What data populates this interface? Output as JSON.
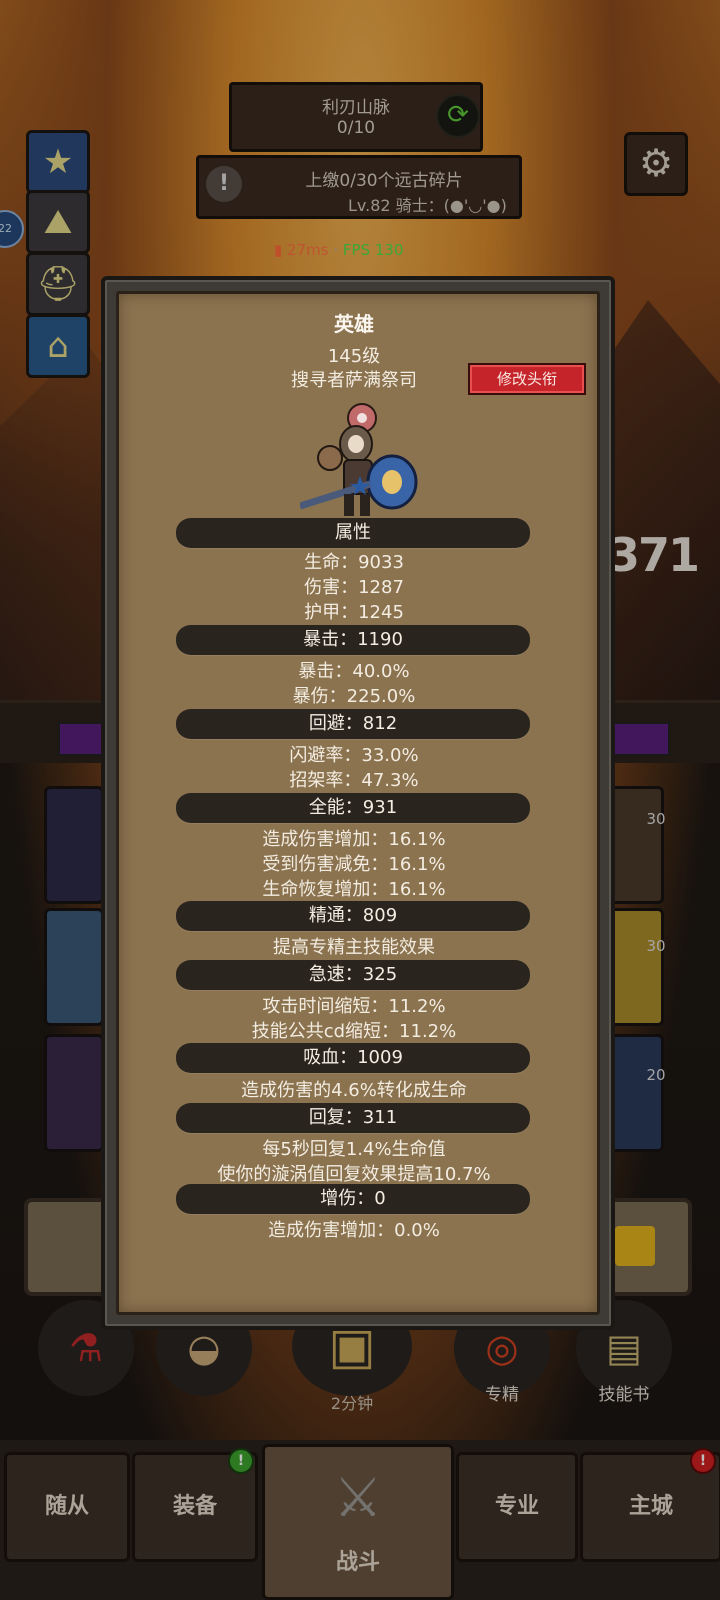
{
  "hud": {
    "region_name": "利刃山脉",
    "region_progress": "0/10",
    "quest_text": "上缴0/30个远古碎片",
    "player_line": "Lv.82 骑士：(●'◡'●)",
    "net_latency": "27ms",
    "net_sep": "·",
    "fps": "FPS 130",
    "left_level": "22"
  },
  "scene": {
    "bignum": "371",
    "badges": [
      "30",
      "30",
      "20"
    ]
  },
  "panel": {
    "title": "英雄",
    "level": "145级",
    "hero_title": "搜寻者萨满祭司",
    "rename_button": "修改头衔",
    "sections": [
      {
        "header": "属性",
        "lines": [
          "生命：9033",
          "伤害：1287",
          "护甲：1245"
        ]
      },
      {
        "header": "暴击：1190",
        "lines": [
          "暴击：40.0%",
          "暴伤：225.0%"
        ]
      },
      {
        "header": "回避：812",
        "lines": [
          "闪避率：33.0%",
          "招架率：47.3%"
        ]
      },
      {
        "header": "全能：931",
        "lines": [
          "造成伤害增加：16.1%",
          "受到伤害减免：16.1%",
          "生命恢复增加：16.1%"
        ]
      },
      {
        "header": "精通：809",
        "lines": [
          "提高专精主技能效果"
        ]
      },
      {
        "header": "急速：325",
        "lines": [
          "攻击时间缩短：11.2%",
          "技能公共cd缩短：11.2%"
        ]
      },
      {
        "header": "吸血：1009",
        "lines": [
          "造成伤害的4.6%转化成生命"
        ]
      },
      {
        "header": "回复：311",
        "lines": [
          "每5秒回复1.4%生命值",
          "使你的漩涡值回复效果提高10.7%"
        ]
      },
      {
        "header": "增伤：0",
        "lines": [
          "造成伤害增加：0.0%"
        ]
      }
    ]
  },
  "actions": {
    "timer": "2分钟",
    "specialization": "专精",
    "skillbook": "技能书"
  },
  "nav": {
    "followers": "随从",
    "equipment": "装备",
    "battle": "战斗",
    "profession": "专业",
    "main_city": "主城",
    "equipment_badge": "!",
    "main_city_badge": "!"
  },
  "colors": {
    "panel_bg": "#8b7350",
    "section_bar": "#2a241e",
    "rename_button": "#c5242b",
    "fps_green": "#4fe04a",
    "latency_orange": "#ff7040"
  }
}
